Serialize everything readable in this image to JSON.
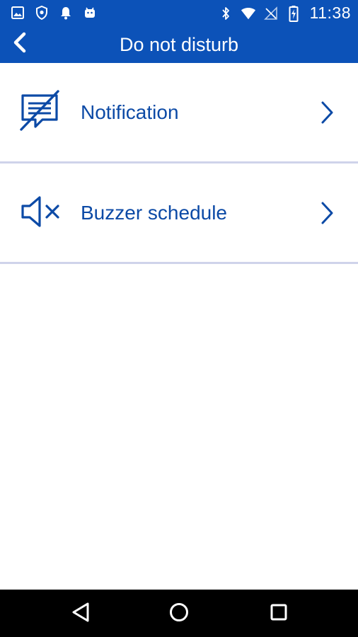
{
  "status_bar": {
    "time": "11:38",
    "left_icons": [
      "image-icon",
      "shield-icon",
      "bell-icon",
      "android-icon"
    ],
    "right_icons": [
      "bluetooth-icon",
      "wifi-icon",
      "no-signal-icon",
      "battery-charging-icon"
    ]
  },
  "app_bar": {
    "title": "Do not disturb",
    "back_icon": "chevron-left-icon"
  },
  "menu": {
    "items": [
      {
        "label": "Notification",
        "icon": "notification-off-icon"
      },
      {
        "label": "Buzzer schedule",
        "icon": "speaker-mute-icon"
      }
    ]
  },
  "nav_bar": {
    "buttons": [
      "back-triangle-icon",
      "home-circle-icon",
      "recents-square-icon"
    ]
  },
  "colors": {
    "primary": "#0c52b8",
    "text_primary": "#0c4aa6",
    "divider": "#cfd3ea",
    "nav_background": "#000000"
  }
}
